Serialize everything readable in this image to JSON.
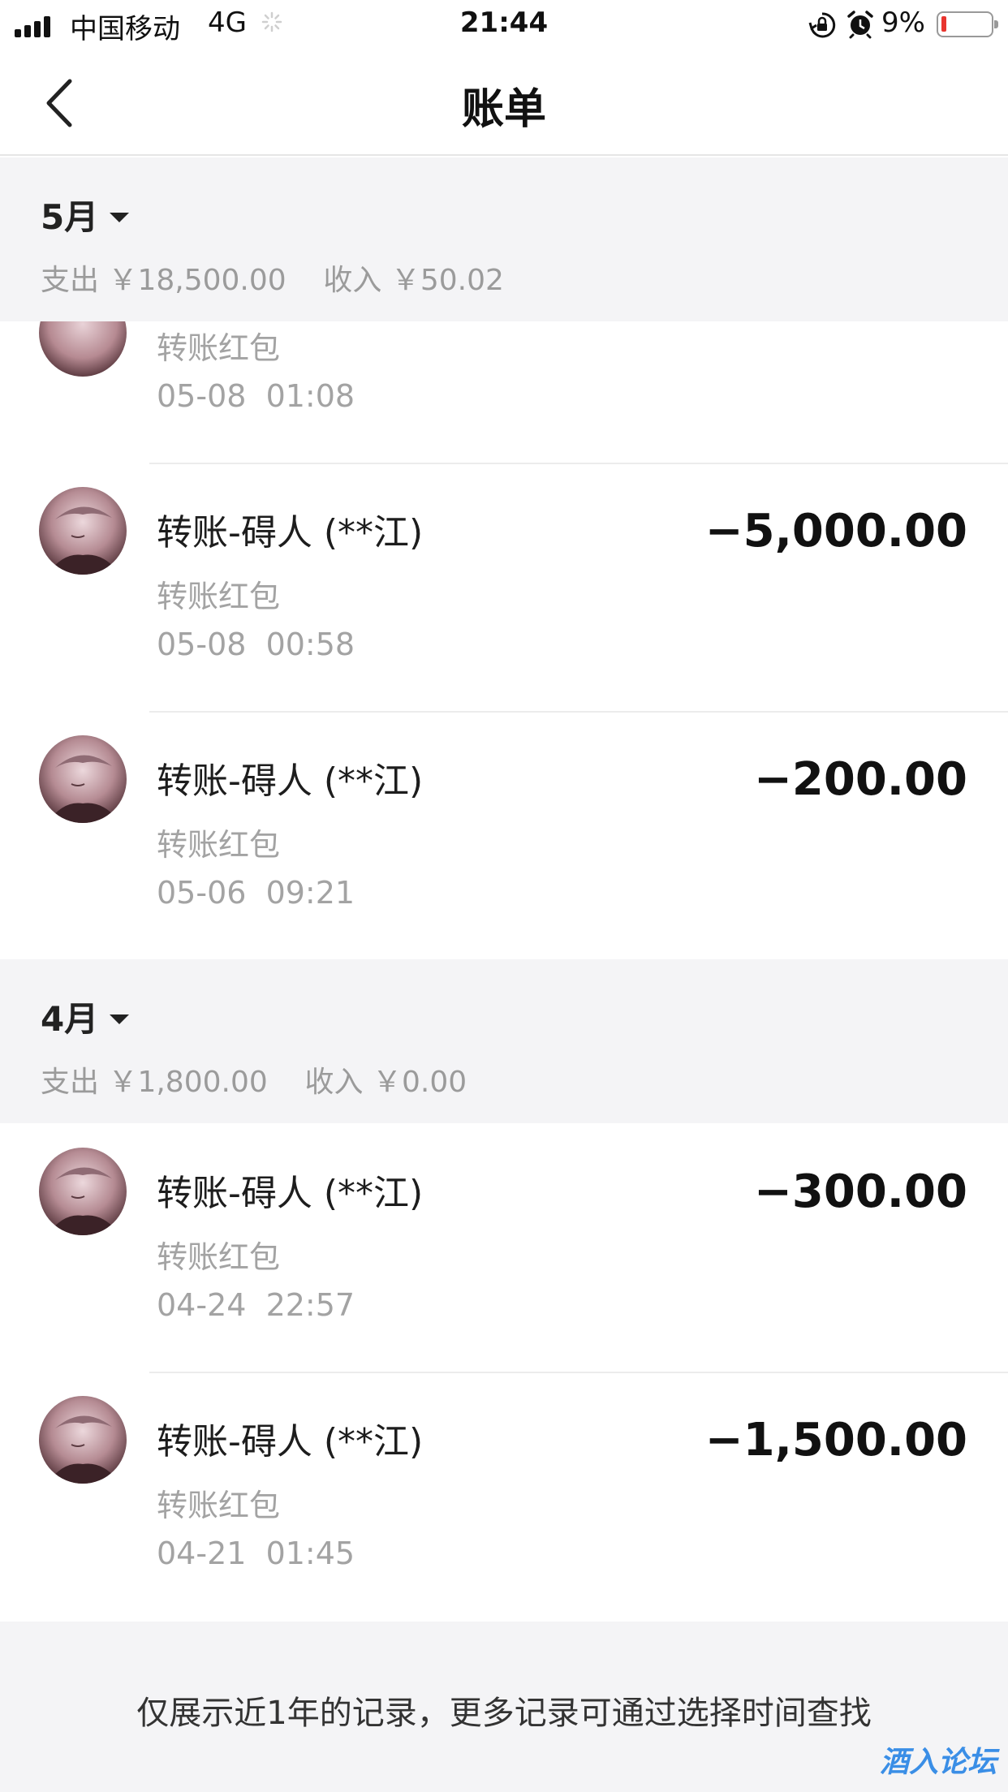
{
  "status_bar": {
    "carrier": "中国移动",
    "network": "4G",
    "time": "21:44",
    "battery": "9%",
    "battery_color": "#e8352f"
  },
  "nav": {
    "title": "账单",
    "back_icon": "chevron-left-icon"
  },
  "months": [
    {
      "label": "5月",
      "summary": "支出 ￥18,500.00    收入 ￥50.02",
      "transactions": [
        {
          "type": "转账红包",
          "time": "05-08  01:08"
        },
        {
          "name": "转账-碍人 (**江)",
          "type": "转账红包",
          "time": "05-08  00:58",
          "amount": "−5,000.00"
        },
        {
          "name": "转账-碍人 (**江)",
          "type": "转账红包",
          "time": "05-06  09:21",
          "amount": "−200.00"
        }
      ]
    },
    {
      "label": "4月",
      "summary": "支出 ￥1,800.00    收入 ￥0.00",
      "transactions": [
        {
          "name": "转账-碍人 (**江)",
          "type": "转账红包",
          "time": "04-24  22:57",
          "amount": "−300.00"
        },
        {
          "name": "转账-碍人 (**江)",
          "type": "转账红包",
          "time": "04-21  01:45",
          "amount": "−1,500.00"
        }
      ]
    }
  ],
  "footer": {
    "note": "仅展示近1年的记录，更多记录可通过选择时间查找"
  },
  "watermark": "酒入论坛"
}
